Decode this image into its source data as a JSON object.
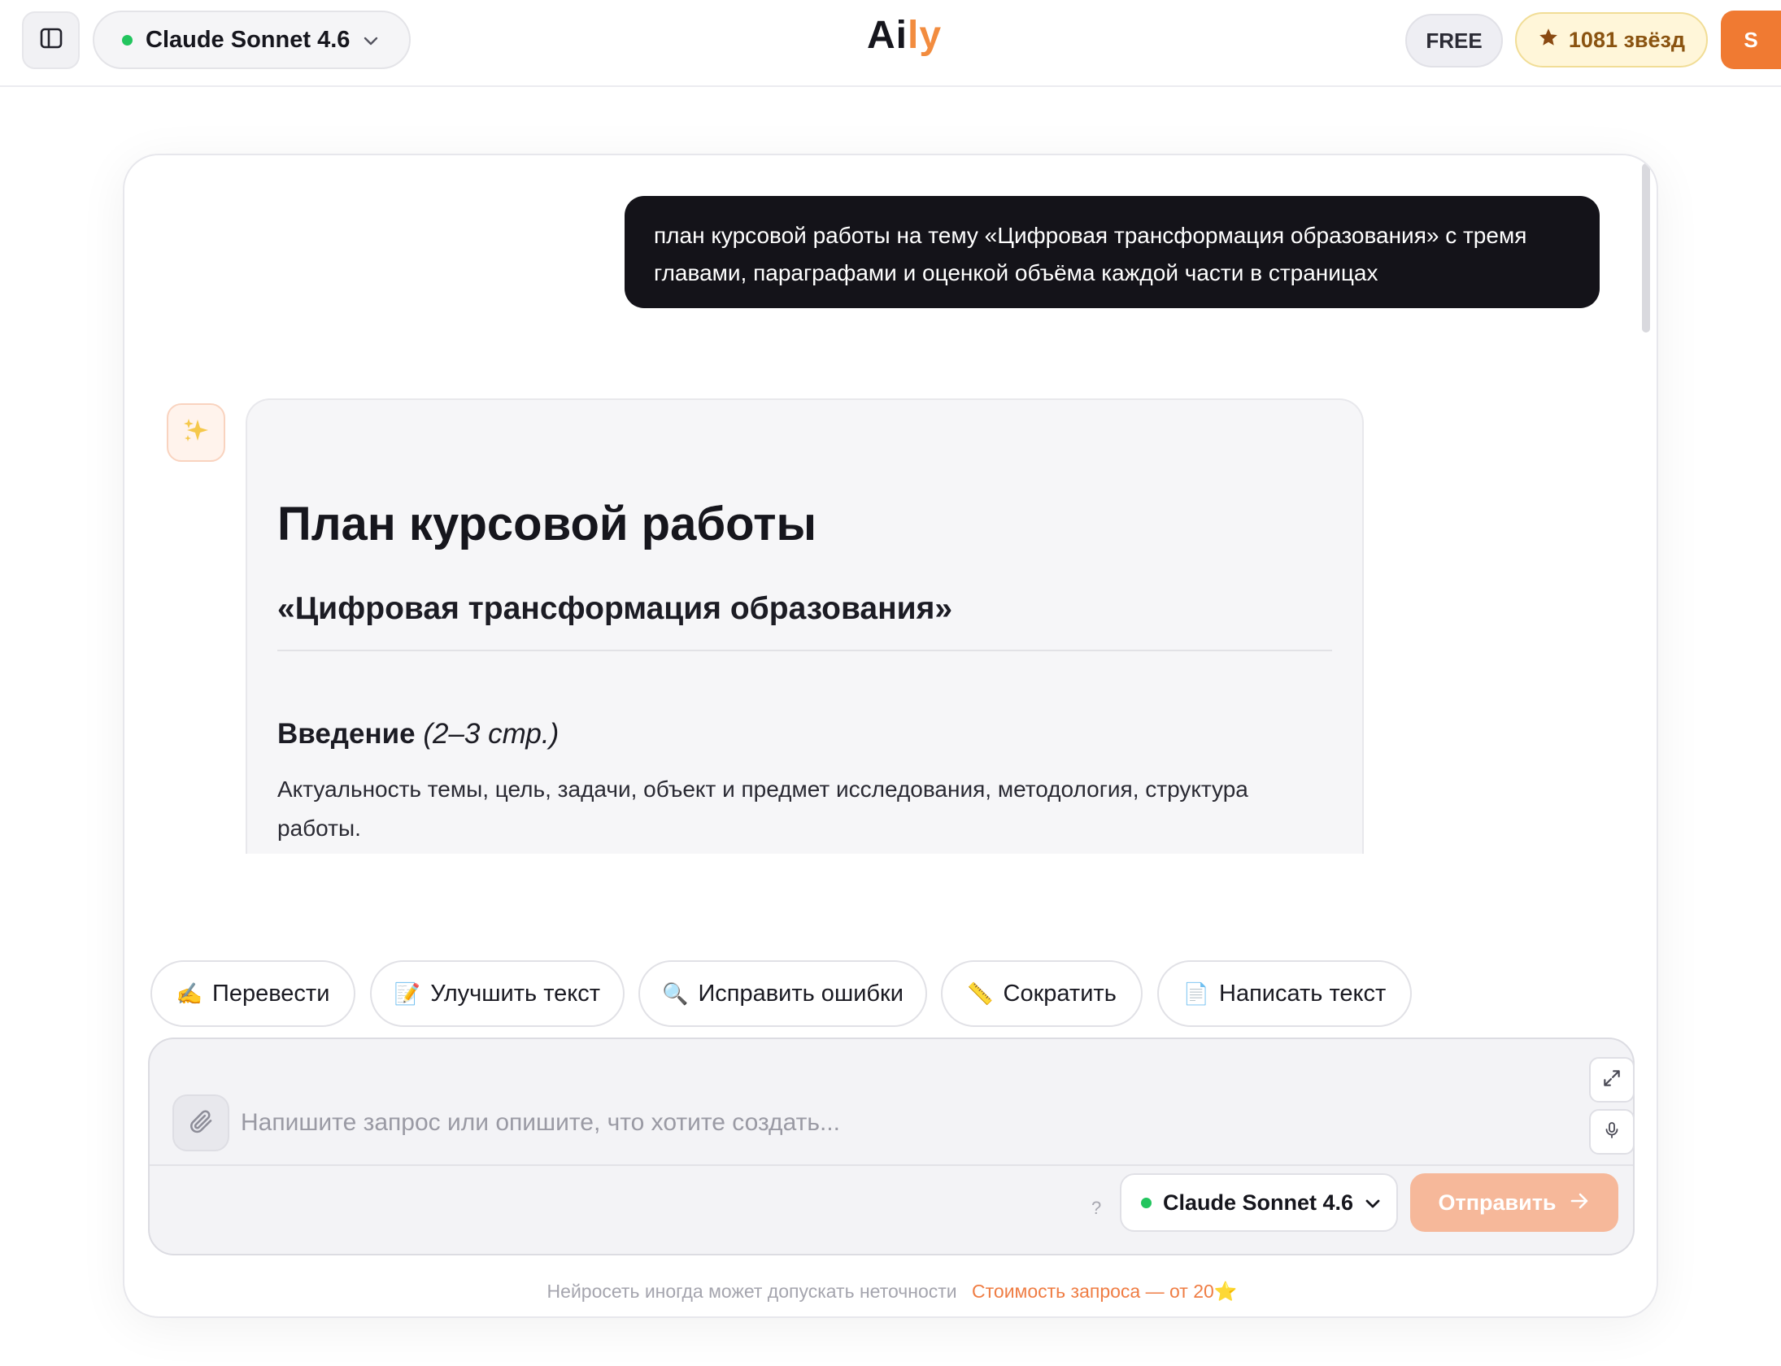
{
  "header": {
    "model_name": "Claude Sonnet 4.6",
    "logo_main": "Ai",
    "logo_accent": "ly",
    "plan_badge": "FREE",
    "stars_label": "1081 звёзд",
    "avatar_initial": "S"
  },
  "chat": {
    "user_message": "план курсовой работы на тему «Цифровая трансформация образования» с тремя главами, параграфами и оценкой объёма каждой части в страницах",
    "answer": {
      "title": "План курсовой работы",
      "subtitle": "«Цифровая трансформация образования»",
      "section_title": "Введение",
      "section_pages": "(2–3 стр.)",
      "section_text": "Актуальность темы, цель, задачи, объект и предмет исследования, методология, структура работы."
    }
  },
  "quick_actions": [
    {
      "emoji": "✍️",
      "label": "Перевести"
    },
    {
      "emoji": "📝",
      "label": "Улучшить текст"
    },
    {
      "emoji": "🔍",
      "label": "Исправить ошибки"
    },
    {
      "emoji": "📏",
      "label": "Сократить"
    },
    {
      "emoji": "📄",
      "label": "Написать текст"
    }
  ],
  "composer": {
    "placeholder": "Напишите запрос или опишите, что хотите создать...",
    "value": "",
    "help": "?",
    "model_name": "Claude Sonnet 4.6",
    "send_label": "Отправить"
  },
  "footer": {
    "disclaimer": "Нейросеть иногда может допускать неточности",
    "cost": "Стоимость запроса — от 20⭐"
  },
  "colors": {
    "accent": "#f07a32",
    "send_button": "#f6b89a",
    "user_bubble": "#141319",
    "status_dot": "#22c55e"
  }
}
